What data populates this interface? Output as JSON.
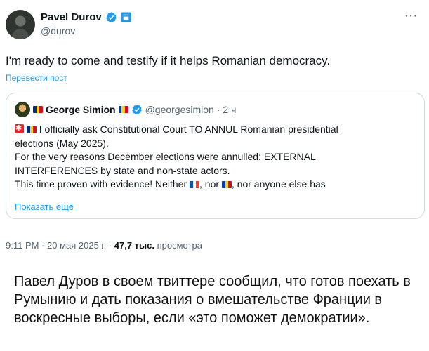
{
  "author": {
    "name": "Pavel Durov",
    "handle": "@durov"
  },
  "tweet": {
    "text": "I'm ready to come and testify if it helps Romanian democracy.",
    "translate_label": "Перевести пост",
    "more_label": "···"
  },
  "quote": {
    "name": "George Simion",
    "handle": "@georgesimion",
    "time": "· 2 ч",
    "lines": [
      "I officially ask Constitutional Court TO ANNUL Romanian presidential",
      "elections (May 2025).",
      "For the very reasons December elections were annulled: EXTERNAL",
      "INTERFERENCES by state and non-state actors.",
      "This time proven with evidence! Neither",
      ", nor",
      ", nor anyone else has"
    ],
    "show_more": "Показать ещё"
  },
  "meta": {
    "time": "9:11 PM · 20 мая 2025 г. ·",
    "views_count": "47,7 тыс.",
    "views_label": "просмотра"
  },
  "caption": "Павел Дуров в своем твиттере сообщил, что готов поехать в Румынию и дать показания о вмешательстве Франции в воскресные выборы, если «это поможет демократии».",
  "colors": {
    "link": "#1d9bf0",
    "verified": "#1d9bf0",
    "muted": "#536471",
    "border": "#cfd9de"
  },
  "icons": [
    "verified-badge-icon",
    "affiliate-badge-icon",
    "more-icon",
    "alert-icon",
    "flag-romania-icon",
    "flag-france-icon",
    "flag-moldova-icon"
  ]
}
